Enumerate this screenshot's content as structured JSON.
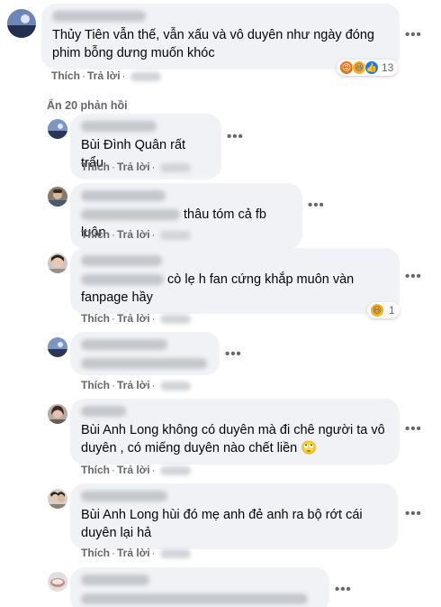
{
  "colors": {
    "bubble": "#f0f2f5",
    "meta": "#65676b",
    "text": "#050505",
    "angry": "#e9710f",
    "haha": "#f7b125",
    "like": "#1877f2"
  },
  "top_comment": {
    "text": "Thủy Tiên vẫn thế, vẫn xấu và vô duyên như ngày đóng phim bỗng dưng muốn khóc",
    "like_label": "Thích",
    "reply_label": "Trả lời",
    "reaction_icons": [
      "angry-icon",
      "haha-icon",
      "like-icon"
    ],
    "reaction_count": "13"
  },
  "hidden_replies_label": "Ẩn 20 phản hồi",
  "replies": [
    {
      "text": "Bùi Đình Quân rất trẩu",
      "like_label": "Thích",
      "reply_label": "Trả lời"
    },
    {
      "text": "thâu tóm cả fb luôn",
      "like_label": "Thích",
      "reply_label": "Trả lời"
    },
    {
      "text": "cò lẹ h fan cứng khắp muôn vàn fanpage hầy",
      "like_label": "Thích",
      "reply_label": "Trả lời",
      "reaction_icon": "haha-icon",
      "reaction_count": "1"
    },
    {
      "text": "",
      "like_label": "Thích",
      "reply_label": "Trả lời"
    },
    {
      "text": "Bùi Anh Long không có duyên mà đi chê người ta vô duyên , có miếng duyên nào chết liền 🙄",
      "like_label": "Thích",
      "reply_label": "Trả lời"
    },
    {
      "text": "Bùi Anh Long hùi đó mẹ anh đẻ anh ra bộ rớt cái duyên lại hả",
      "like_label": "Thích",
      "reply_label": "Trả lời"
    },
    {
      "text": "",
      "like_label": "Thích",
      "reply_label": "Trả lời"
    }
  ],
  "more_label": "•••"
}
